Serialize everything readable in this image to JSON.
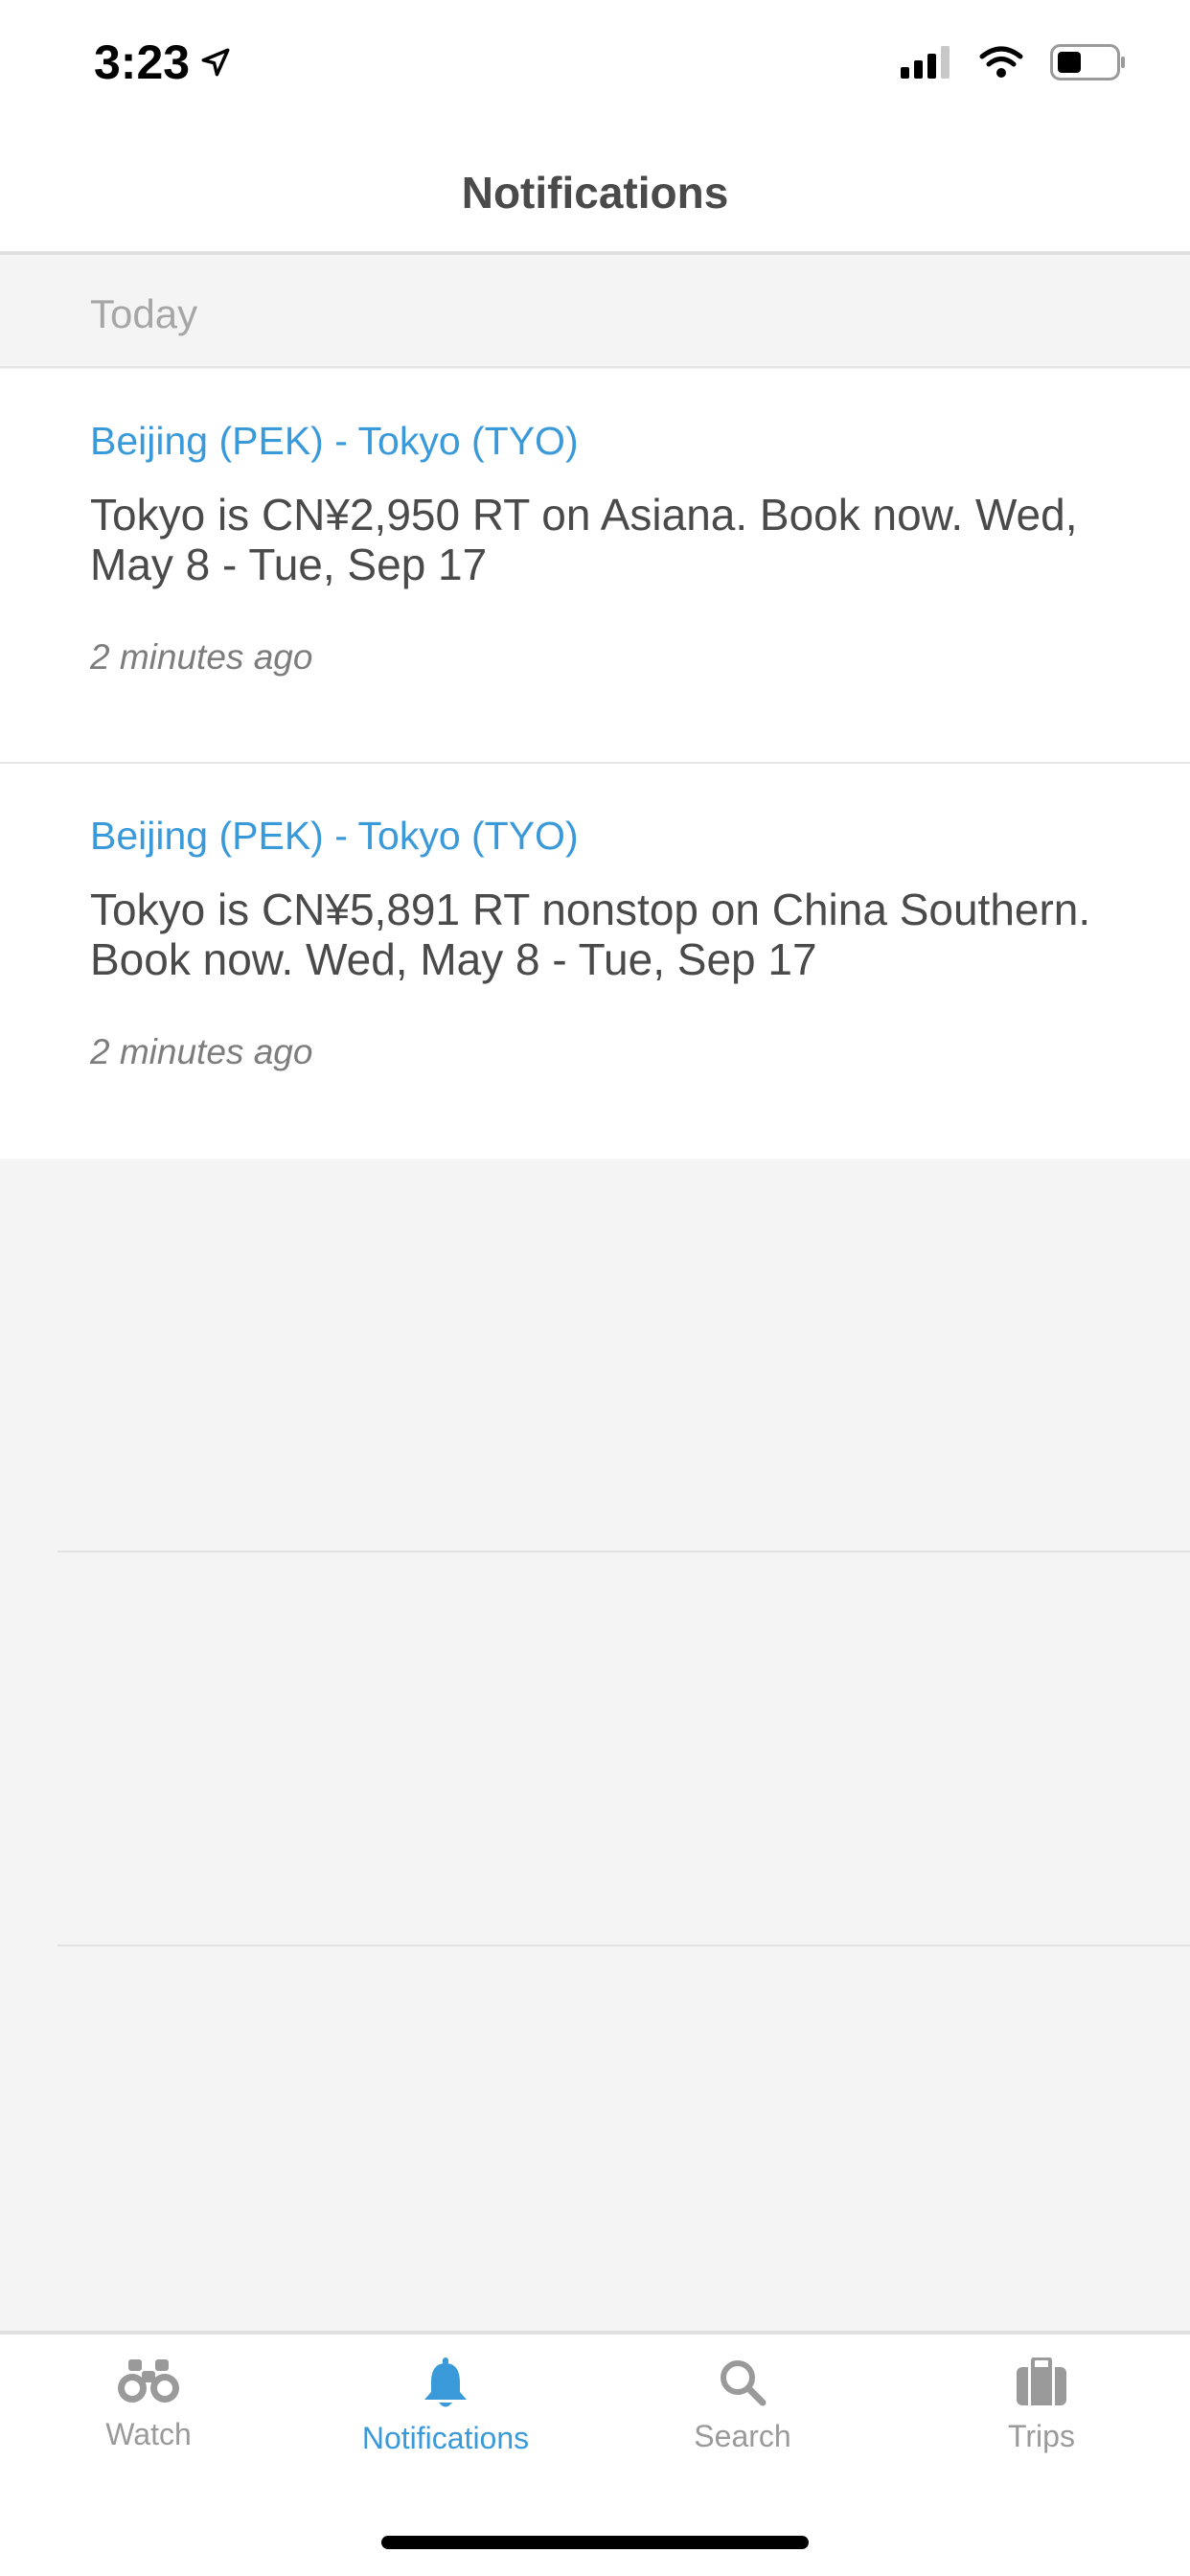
{
  "status_bar": {
    "time": "3:23",
    "icons": [
      "location-arrow-icon",
      "cellular-signal-icon",
      "wifi-icon",
      "battery-icon"
    ]
  },
  "header": {
    "title": "Notifications"
  },
  "section": {
    "label": "Today"
  },
  "notifications": [
    {
      "route": "Beijing (PEK) - Tokyo (TYO)",
      "message": "Tokyo is CN¥2,950 RT on Asiana. Book now. Wed, May 8 - Tue, Sep 17",
      "time": "2 minutes ago"
    },
    {
      "route": "Beijing (PEK) - Tokyo (TYO)",
      "message": "Tokyo is CN¥5,891 RT nonstop on China Southern. Book now. Wed, May 8 - Tue, Sep 17",
      "time": "2 minutes ago"
    }
  ],
  "tab_bar": {
    "tabs": [
      {
        "label": "Watch",
        "icon": "binoculars-icon",
        "active": false
      },
      {
        "label": "Notifications",
        "icon": "bell-icon",
        "active": true
      },
      {
        "label": "Search",
        "icon": "search-icon",
        "active": false
      },
      {
        "label": "Trips",
        "icon": "suitcase-icon",
        "active": false
      }
    ]
  },
  "colors": {
    "accent": "#3a9ad9",
    "text_primary": "#4a4a4a",
    "text_muted": "#7d7d7d",
    "background": "#f4f4f4"
  }
}
